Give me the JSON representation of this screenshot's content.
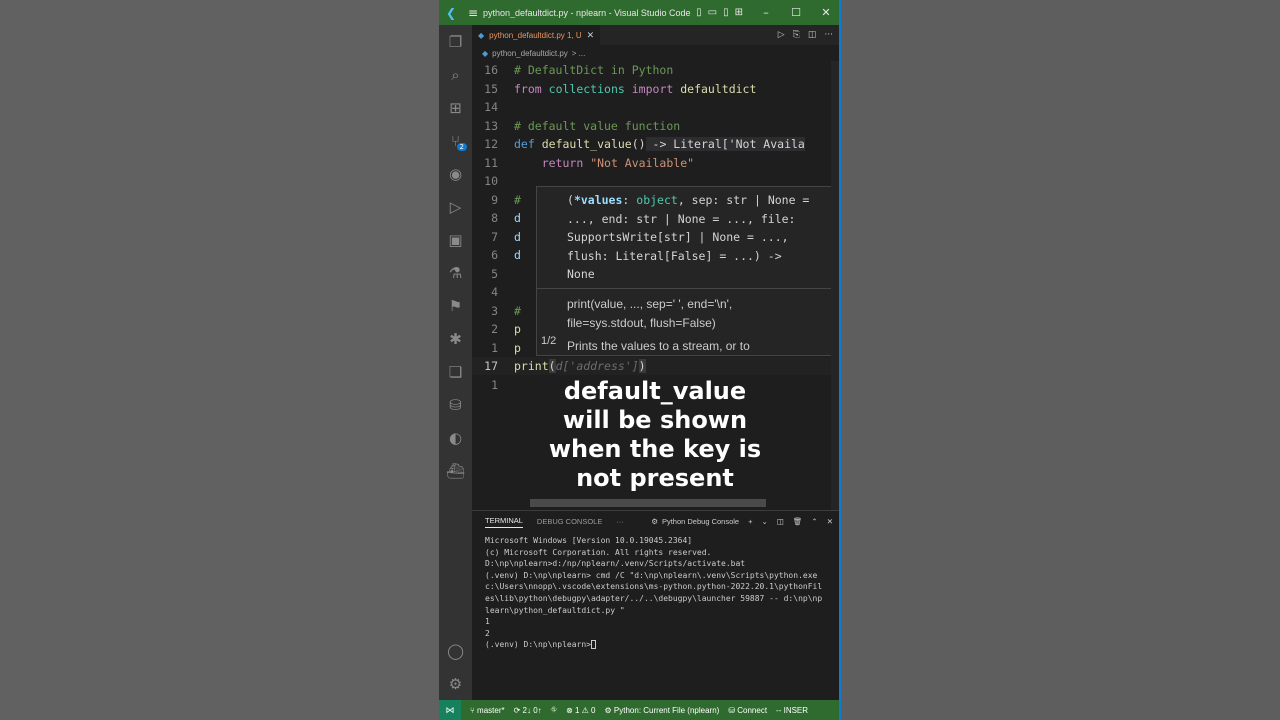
{
  "window": {
    "title": "python_defaultdict.py - nplearn - Visual Studio Code",
    "minimize": "–",
    "maximize": "☐",
    "close": "✕"
  },
  "tab": {
    "label": "python_defaultdict.py 1, U",
    "close": "✕"
  },
  "breadcrumb": {
    "file": "python_defaultdict.py",
    "rest": "> ..."
  },
  "code": {
    "l16": {
      "num": "16",
      "text": "# DefaultDict in Python"
    },
    "l15": {
      "num": "15",
      "kw": "from",
      "mod": "collections",
      "kw2": "import",
      "name": "defaultdict"
    },
    "l14": {
      "num": "14"
    },
    "l13": {
      "num": "13",
      "text": "# default value function"
    },
    "l12": {
      "num": "12",
      "kw": "def",
      "fn": "default_value",
      "paren": "()",
      "hint": " -> Literal['Not Availa"
    },
    "l11": {
      "num": "11",
      "kw": "return",
      "str": "\"Not Available\""
    },
    "l10": {
      "num": "10"
    },
    "l9": {
      "num": "9",
      "text": "#"
    },
    "l8": {
      "num": "8",
      "text": "d"
    },
    "l7": {
      "num": "7",
      "text": "d"
    },
    "l6": {
      "num": "6",
      "text": "d"
    },
    "l5": {
      "num": "5"
    },
    "l4": {
      "num": "4"
    },
    "l3": {
      "num": "3",
      "text": "#"
    },
    "l2": {
      "num": "2",
      "text": "p"
    },
    "l1": {
      "num": "1",
      "text": "p"
    },
    "l17": {
      "num": "17",
      "fn": "print",
      "open": "(",
      "ghost": "d['address']",
      "close": ")"
    },
    "l1b": {
      "num": "1"
    }
  },
  "hover": {
    "sig1a": "(",
    "sig1p": "*values",
    "sig1b": ": ",
    "sig1t": "object",
    "sig1c": ", sep: str | None =",
    "sig2": "..., end: str | None = ..., file:",
    "sig3": "SupportsWrite[str] | None = ...,",
    "sig4": "flush: Literal[False] = ...) ->",
    "sig5": "None",
    "doc1": "print(value, ..., sep=' ', end='\\n',",
    "doc2": "file=sys.stdout, flush=False)",
    "doc3": "Prints the values to a stream, or to",
    "counter": "1/2"
  },
  "overlay": {
    "line1": "default_value",
    "line2": "will be shown",
    "line3": "when the key is",
    "line4": "not present"
  },
  "panel": {
    "tab_terminal": "TERMINAL",
    "tab_debug": "DEBUG CONSOLE",
    "more": "···",
    "debug_console": "Python Debug Console"
  },
  "terminal": {
    "lines": [
      "Microsoft Windows [Version 10.0.19045.2364]",
      "(c) Microsoft Corporation. All rights reserved.",
      "",
      "D:\\np\\nplearn>d:/np/nplearn/.venv/Scripts/activate.bat",
      "",
      "(.venv) D:\\np\\nplearn> cmd /C \"d:\\np\\nplearn\\.venv\\Scripts\\python.exe",
      "c:\\Users\\nnopp\\.vscode\\extensions\\ms-python.python-2022.20.1\\pythonFil",
      "es\\lib\\python\\debugpy\\adapter/../..\\debugpy\\launcher 59887 -- d:\\np\\np",
      "learn\\python_defaultdict.py \"",
      "1",
      "2",
      ""
    ],
    "prompt": "(.venv) D:\\np\\nplearn>"
  },
  "status": {
    "branch": "master*",
    "sync": "2↓ 0↑",
    "problems": "⊗ 1 ⚠ 0",
    "interpreter": "Python: Current File (nplearn)",
    "connect": "Connect",
    "mode": "-- INSER"
  },
  "colors": {
    "titlebar": "#2f6b2e",
    "statusbar": "#2f6b2e",
    "editor_bg": "#1e1e1e",
    "accent": "#0e7ad1"
  }
}
